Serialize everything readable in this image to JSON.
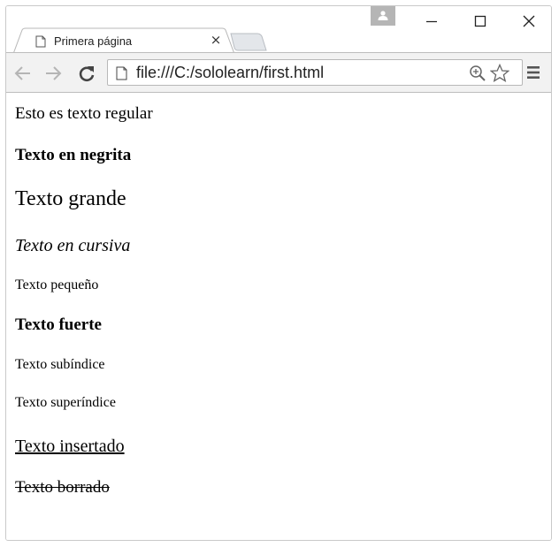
{
  "browser": {
    "tab": {
      "title": "Primera página",
      "close_glyph": "×",
      "icon": "page-icon"
    },
    "address_bar": {
      "url": "file:///C:/sololearn/first.html"
    },
    "icons": [
      "back-arrow-icon",
      "forward-arrow-icon",
      "reload-icon",
      "page-icon",
      "zoom-icon",
      "star-icon",
      "menu-icon",
      "profile-icon",
      "minimize-icon",
      "maximize-icon",
      "close-icon"
    ]
  },
  "page": {
    "regular": "Esto es texto regular",
    "bold": "Texto en negrita",
    "big": "Texto grande",
    "italic": "Texto en cursiva",
    "small": "Texto pequeño",
    "strong": "Texto fuerte",
    "subscript": "Texto subíndice",
    "superscript": "Texto superíndice",
    "inserted": "Texto insertado",
    "deleted": "Texto borrado"
  }
}
